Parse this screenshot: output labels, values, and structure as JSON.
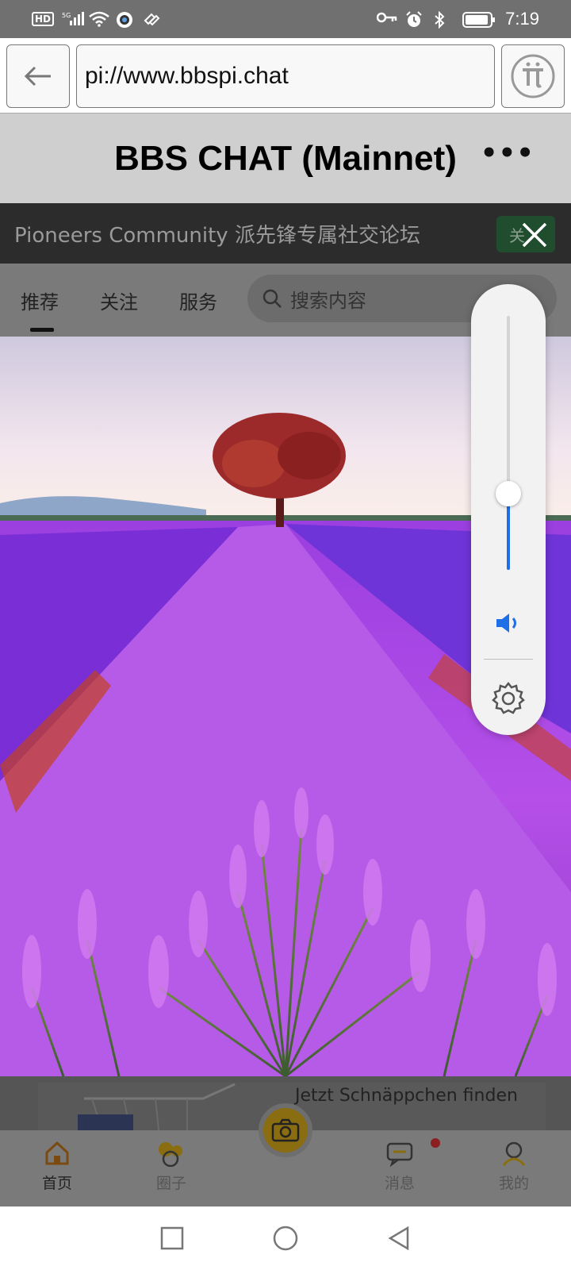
{
  "status_bar": {
    "network_label": "HD",
    "signal_label": "5G",
    "time": "7:19"
  },
  "browser": {
    "url": "pi://www.bbspi.chat"
  },
  "app_bar": {
    "title": "BBS CHAT (Mainnet)"
  },
  "page": {
    "community_text": "Pioneers Community 派先锋专属社交论坛",
    "follow_label": "关",
    "tabs": [
      {
        "label": "推荐"
      },
      {
        "label": "关注"
      },
      {
        "label": "服务"
      }
    ],
    "search_placeholder": "搜索内容",
    "ad_text": "Jetzt Schnäppchen finden"
  },
  "bottom_nav": {
    "items": [
      {
        "label": "首页"
      },
      {
        "label": "圈子"
      },
      {
        "label": "消息"
      },
      {
        "label": "我的"
      }
    ]
  },
  "volume_panel": {
    "level": 0.3,
    "accent": "#1f6fe6"
  }
}
